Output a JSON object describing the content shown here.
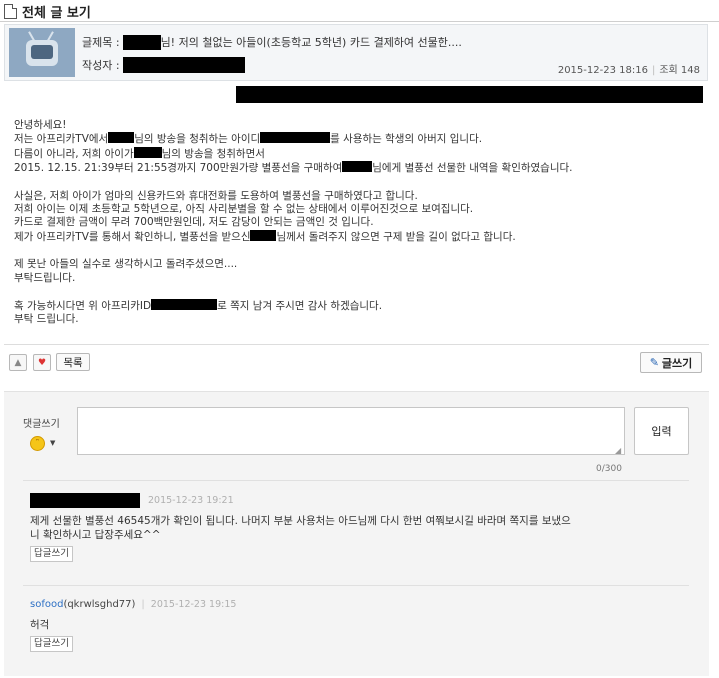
{
  "header": {
    "title": "전체 글 보기"
  },
  "post": {
    "subject_label": "글제목 :",
    "subject_text": "님! 저의 철없는 아들이(초등학교 5학년) 카드 결제하여 선물한....",
    "author_label": "작성자 :",
    "date": "2015-12-23 18:16",
    "views": "조회 148",
    "body": {
      "l1": "안녕하세요!",
      "l2a": "저는 아프리카TV에서",
      "l2b": "님의 방송을 청취하는 아이디",
      "l2c": "를 사용하는 학생의 아버지 입니다.",
      "l3a": "다름이 아니라, 저희 아이가",
      "l3b": "님의 방송을 청취하면서",
      "l4a": "2015. 12.15. 21:39부터 21:55경까지 700만원가량 별풍선을 구매하여",
      "l4b": "님에게 별풍선 선물한 내역을 확인하였습니다.",
      "l5": "사실은, 저희 아이가 엄마의 신용카드와 휴대전화를 도용하여 별풍선을 구매하였다고 합니다.",
      "l6": "저희 아이는 이제 초등학교 5학년으로, 아직 사리분별을 할 수 없는 상태에서 이루어진것으로 보여집니다.",
      "l7": "카드로 결제한 금액이 무려 700백만원인데, 저도 감당이 안되는 금액인 것 입니다.",
      "l8a": "제가 아프리카TV를 통해서 확인하니, 별풍선을 받으신",
      "l8b": "님께서 돌려주지 않으면 구제 받을 길이 없다고 합니다.",
      "l9": "제 못난 아들의 실수로 생각하시고 돌려주셨으면....",
      "l10": "부탁드립니다.",
      "l11a": "혹 가능하시다면 위 아프리카ID",
      "l11b": "로 쪽지 남겨 주시면 감사 하겠습니다.",
      "l12": "부탁 드립니다."
    }
  },
  "actions": {
    "up_icon": "triangle-up-icon",
    "heart_icon": "heart-icon",
    "list_label": "목록",
    "write_label": "글쓰기",
    "write_icon": "pencil-icon"
  },
  "comment_form": {
    "label": "댓글쓰기",
    "emoji": "emoji-icon",
    "submit_label": "입력",
    "counter": "0/300"
  },
  "comments": [
    {
      "date": "2015-12-23 19:21",
      "body": "제게 선물한 별풍선 46545개가 확인이 됩니다. 나머지 부분 사용처는 아드님께 다시 한번 여쭤보시길 바라며 쪽지를 보냈으\n니 확인하시고 답장주세요^^",
      "reply_label": "답글쓰기"
    },
    {
      "user": "sofood",
      "uid": "(qkrwlsghd77)",
      "date": "2015-12-23 19:15",
      "body": "허걱",
      "reply_label": "답글쓰기"
    }
  ],
  "colors": {
    "link_blue": "#2c6fc4",
    "redaction": "#000000",
    "comment_bg": "#f4f4f4"
  }
}
